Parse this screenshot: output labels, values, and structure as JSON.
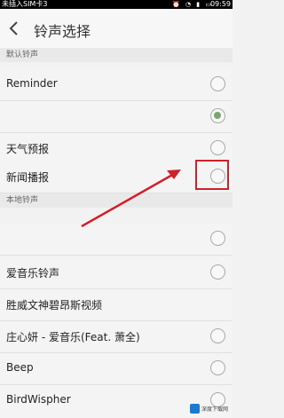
{
  "status_bar": {
    "carrier": "未插入SIM卡3",
    "time": "09:59",
    "icons": [
      "alarm-icon",
      "wifi-icon",
      "signal-icon",
      "battery-icon"
    ]
  },
  "header": {
    "title": "铃声选择",
    "back_icon": "back-arrow-icon"
  },
  "sections": {
    "default_label": "默认铃声",
    "local_label": "本地铃声"
  },
  "default_items": [
    {
      "label": "Reminder",
      "checked": false
    },
    {
      "label": "",
      "checked": true
    },
    {
      "label": "天气预报",
      "checked": false
    },
    {
      "label": "新闻播报",
      "checked": false
    }
  ],
  "local_items": [
    {
      "label": "",
      "checked": false
    },
    {
      "label": "爱音乐铃声",
      "checked": false
    },
    {
      "label": "胜威文神碧昂斯视频",
      "checked": false
    },
    {
      "label": "庄心妍 - 爱音乐(Feat. 萧全)",
      "checked": false
    },
    {
      "label": "Beep",
      "checked": false
    },
    {
      "label": "BirdWispher",
      "checked": false
    }
  ],
  "annotation": {
    "color": "#d0202a"
  },
  "watermark": {
    "text": "深度下载网"
  }
}
